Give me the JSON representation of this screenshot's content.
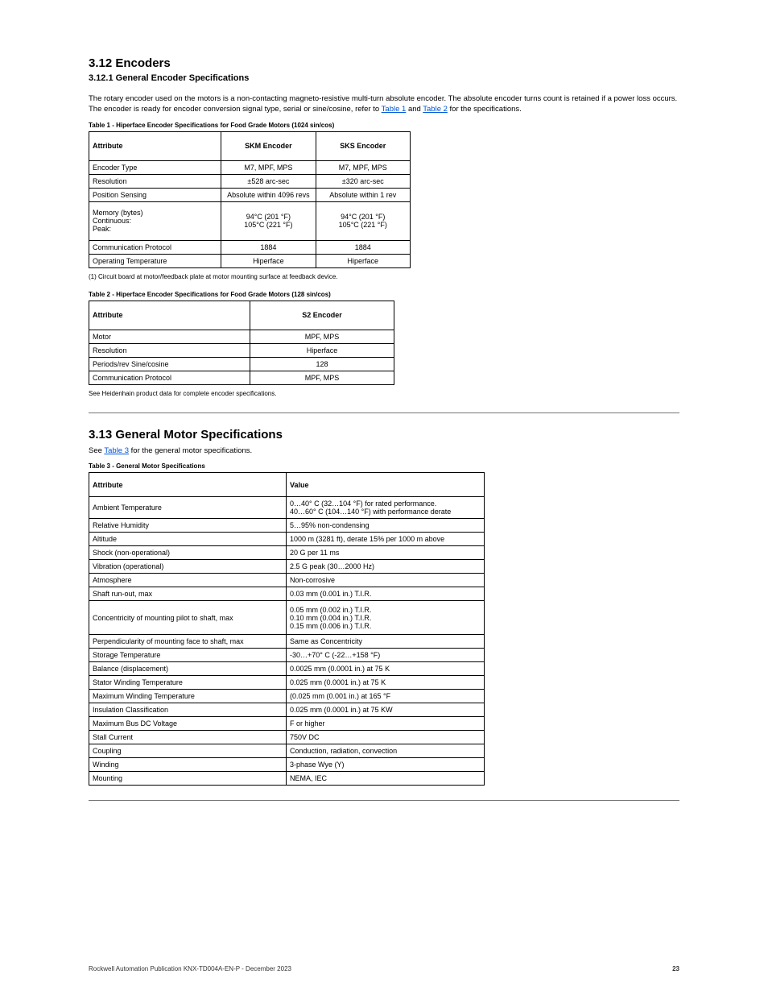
{
  "header": {
    "title_main": "3.12 Encoders",
    "title_sub": "3.12.1 General Encoder Specifications"
  },
  "intro": {
    "para": "The rotary encoder used on the motors is a non-contacting magneto-resistive multi-turn absolute encoder. The absolute encoder turns count is retained if a power loss occurs. The encoder is ready for encoder conversion signal type, serial or sine/cosine, refer to ",
    "link1": "Table 1",
    "para_mid": " and ",
    "link2": "Table 2",
    "para_end": " for the specifications."
  },
  "table1": {
    "caption": "Table 1 - Hiperface Encoder Specifications for Food Grade Motors (1024 sin/cos)",
    "cols": [
      "Attribute",
      "SKM Encoder",
      "SKS Encoder"
    ],
    "rows": [
      [
        "Encoder Type",
        "M7, MPF, MPS",
        "M7, MPF, MPS"
      ],
      [
        "Resolution",
        "±528 arc-sec",
        "±320 arc-sec"
      ],
      [
        "Position Sensing",
        "Absolute within 4096 revs",
        "Absolute within 1 rev"
      ],
      [
        "Memory (bytes)\nContinuous:\nPeak:",
        "94°C (201 °F)\n105°C (221 °F)",
        "94°C (201 °F)\n105°C (221 °F)"
      ],
      [
        "Communication Protocol",
        "1884",
        "1884"
      ],
      [
        "Operating Temperature",
        "Hiperface",
        "Hiperface"
      ]
    ],
    "footnote": "(1) Circuit board at motor/feedback plate at motor mounting surface at feedback device."
  },
  "table2": {
    "caption": "Table 2 - Hiperface Encoder Specifications for Food Grade Motors (128 sin/cos)",
    "cols": [
      "Attribute",
      "S2 Encoder"
    ],
    "rows": [
      [
        "Motor",
        "MPF, MPS"
      ],
      [
        "Resolution",
        "Hiperface"
      ],
      [
        "Periods/rev Sine/cosine",
        "128"
      ],
      [
        "Communication Protocol",
        "MPF, MPS"
      ]
    ],
    "footnote": "See Heidenhain product data for complete encoder specifications."
  },
  "sec2": {
    "heading": "3.13 General Motor Specifications",
    "intro": "See ",
    "link": "Table 3",
    "intro_end": " for the general motor specifications."
  },
  "table3": {
    "caption": "Table 3 - General Motor Specifications",
    "cols": [
      "Attribute",
      "Value"
    ],
    "rows": [
      [
        "Ambient Temperature",
        "0…40° C (32…104 °F) for rated performance.\n40…60° C (104…140 °F) with performance derate"
      ],
      [
        "Relative Humidity",
        "5…95% non-condensing"
      ],
      [
        "Altitude",
        "1000 m (3281 ft), derate 15% per 1000 m above"
      ],
      [
        "Shock (non-operational)",
        "20 G per 11 ms"
      ],
      [
        "Vibration (operational)",
        "2.5 G peak (30…2000 Hz)"
      ],
      [
        "Atmosphere",
        "Non-corrosive"
      ],
      [
        "Shaft run-out, max",
        "0.03 mm (0.001 in.) T.I.R."
      ],
      [
        "Concentricity of mounting pilot to shaft, max",
        "0.05 mm (0.002 in.) T.I.R.\n0.10 mm (0.004 in.) T.I.R.\n0.15 mm (0.006 in.) T.I.R."
      ],
      [
        "Perpendicularity of mounting face to shaft, max",
        "Same as Concentricity"
      ],
      [
        "Storage Temperature",
        "-30…+70° C (-22…+158 °F)"
      ],
      [
        "Balance (displacement)",
        "0.0025 mm (0.0001 in.) at 75 K"
      ],
      [
        "Stator Winding Temperature",
        "0.025 mm (0.0001 in.) at 75 K"
      ],
      [
        "Maximum Winding Temperature",
        "(0.025 mm (0.001 in.) at 165 °F"
      ],
      [
        "Insulation Classification",
        "0.025 mm (0.0001 in.) at 75 KW"
      ],
      [
        "Maximum Bus DC Voltage",
        "F or higher"
      ],
      [
        "Stall Current",
        "750V DC"
      ],
      [
        "Coupling",
        "Conduction, radiation, convection"
      ],
      [
        "Winding",
        "3-phase Wye (Y)"
      ],
      [
        "Mounting",
        "NEMA, IEC"
      ]
    ]
  },
  "footer": {
    "left": "Rockwell Automation Publication KNX-TD004A-EN-P - December 2023",
    "right": "23"
  }
}
